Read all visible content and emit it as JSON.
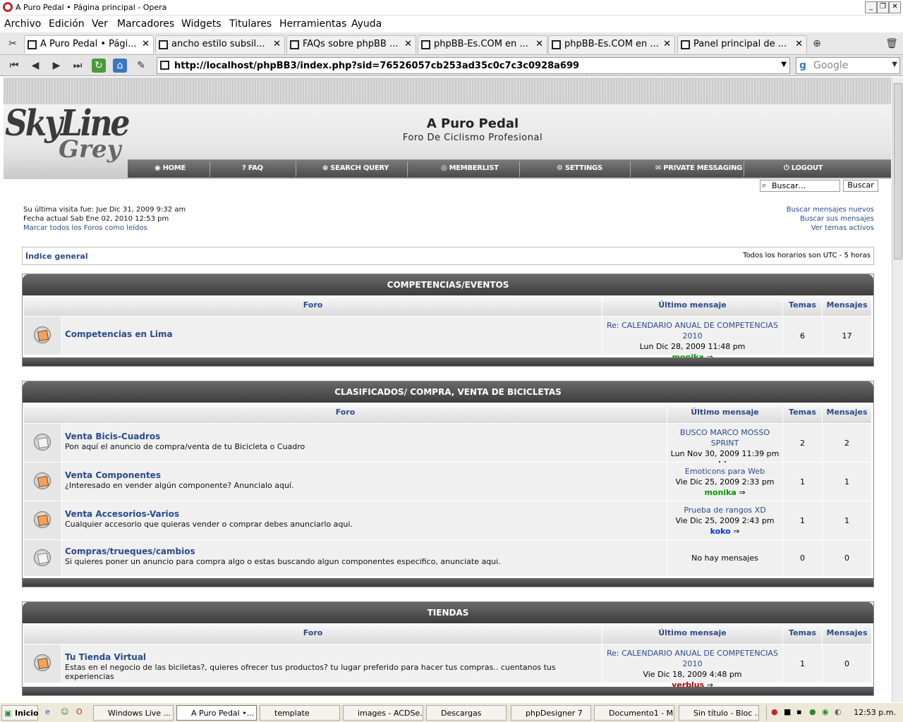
{
  "window": {
    "title": "A Puro Pedal • Página principal - Opera"
  },
  "menu": [
    "Archivo",
    "Edición",
    "Ver",
    "Marcadores",
    "Widgets",
    "Titulares",
    "Herramientas",
    "Ayuda"
  ],
  "tabs": [
    {
      "label": "A Puro Pedal • Pági..."
    },
    {
      "label": "ancho estilo subsil..."
    },
    {
      "label": "FAQs sobre phpBB ..."
    },
    {
      "label": "phpBB-Es.COM en ..."
    },
    {
      "label": "phpBB-Es.COM en ..."
    },
    {
      "label": "Panel principal de ..."
    }
  ],
  "address": {
    "url": "http://localhost/phpBB3/index.php?sid=76526057cb253ad35c0c7c3c0928a699",
    "search_placeholder": "Google"
  },
  "site": {
    "name": "A Puro Pedal",
    "description": "Foro De Ciclismo Profesional",
    "logo_line1": "SkyLine",
    "logo_line2": "Grey",
    "nav": [
      "HOME",
      "FAQ",
      "SEARCH QUERY",
      "MEMBERLIST",
      "SETTINGS",
      "PRIVATE MESSAGING",
      "LOGOUT"
    ],
    "search_placeholder": "Buscar…",
    "search_button": "Buscar"
  },
  "info": {
    "last_visit": "Su última visita fue: Jue Dic 31, 2009 9:32 am",
    "current_date": "Fecha actual Sab Ene 02, 2010 12:53 pm",
    "mark_read": "Marcar todos los Foros como leídos",
    "new_posts": "Buscar mensajes nuevos",
    "your_posts": "Buscar sus mensajes",
    "active_topics": "Ver temas activos"
  },
  "breadcrumb": {
    "index": "Índice general",
    "timezone": "Todos los horarios son UTC - 5 horas"
  },
  "table_headers": {
    "forum": "Foro",
    "last_post": "Último mensaje",
    "topics": "Temas",
    "posts": "Mensajes"
  },
  "categories": [
    {
      "name": "COMPETENCIAS/EVENTOS",
      "forums": [
        {
          "title": "Competencias en Lima",
          "desc": "",
          "unread": true,
          "last_subject": "Re: CALENDARIO ANUAL DE COMPETENCIAS 2010",
          "last_date": "Lun Dic 28, 2009 11:48 pm",
          "last_author": "monika",
          "author_color": "#009900",
          "topics": "6",
          "posts": "17"
        }
      ]
    },
    {
      "name": "CLASIFICADOS/ COMPRA, VENTA DE BICICLETAS",
      "forums": [
        {
          "title": "Venta Bicis-Cuadros",
          "desc": "Pon aquí el anuncio de compra/venta de tu Bicicleta o Cuadro",
          "unread": false,
          "last_subject": "BUSCO MARCO MOSSO SPRINT",
          "last_date": "Lun Nov 30, 2009 11:39 pm",
          "last_author": "yerblus",
          "author_color": "#aa0000",
          "topics": "2",
          "posts": "2"
        },
        {
          "title": "Venta Componentes",
          "desc": "¿Interesado en vender algún componente? Anuncialo aquí.",
          "unread": true,
          "last_subject": "Emoticons para Web",
          "last_date": "Vie Dic 25, 2009 2:33 pm",
          "last_author": "monika",
          "author_color": "#009900",
          "topics": "1",
          "posts": "1"
        },
        {
          "title": "Venta Accesorios-Varios",
          "desc": "Cualquier accesorio que quieras vender o comprar debes anunciarlo aqui.",
          "unread": true,
          "last_subject": "Prueba de rangos XD",
          "last_date": "Vie Dic 25, 2009 2:43 pm",
          "last_author": "koko",
          "author_color": "#0033cc",
          "topics": "1",
          "posts": "1"
        },
        {
          "title": "Compras/trueques/cambios",
          "desc": "Si quieres poner un anuncio para compra algo o estas buscando algun componentes especifico, anunciate aqui.",
          "unread": false,
          "no_posts": "No hay mensajes",
          "topics": "0",
          "posts": "0"
        }
      ]
    },
    {
      "name": "TIENDAS",
      "forums": [
        {
          "title": "Tu Tienda Virtual",
          "desc": "Estas en el negocio de las biciletas?, quieres ofrecer tus productos? tu lugar preferido para hacer tus compras.. cuentanos tus experiencias",
          "unread": true,
          "last_subject": "Re: CALENDARIO ANUAL DE COMPETENCIAS 2010",
          "last_date": "Vie Dic 18, 2009 4:48 pm",
          "last_author": "yerblus",
          "author_color": "#aa0000",
          "topics": "1",
          "posts": "0"
        }
      ]
    }
  ],
  "taskbar": {
    "start": "Inicio",
    "items": [
      "Windows Live ...",
      "A Puro Pedal •...",
      "template",
      "images - ACDSe...",
      "Descargas",
      "phpDesigner 7",
      "Documento1 - M...",
      "Sin título - Bloc ..."
    ],
    "clock": "12:53 p.m."
  }
}
